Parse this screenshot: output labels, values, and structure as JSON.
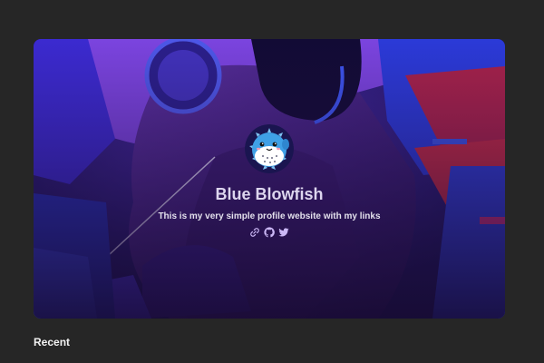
{
  "profile": {
    "name": "Blue Blowfish",
    "tagline": "This is my very simple profile website with my links",
    "links": [
      {
        "icon": "link-icon"
      },
      {
        "icon": "github-icon"
      },
      {
        "icon": "twitter-icon"
      }
    ]
  },
  "sections": {
    "recent_title": "Recent"
  },
  "colors": {
    "page_background": "#262626",
    "hero_blue": "#2b2fb8",
    "hero_purple": "#7a3fd8",
    "hero_red": "#b3233f",
    "text_light": "#ddd6ee"
  }
}
